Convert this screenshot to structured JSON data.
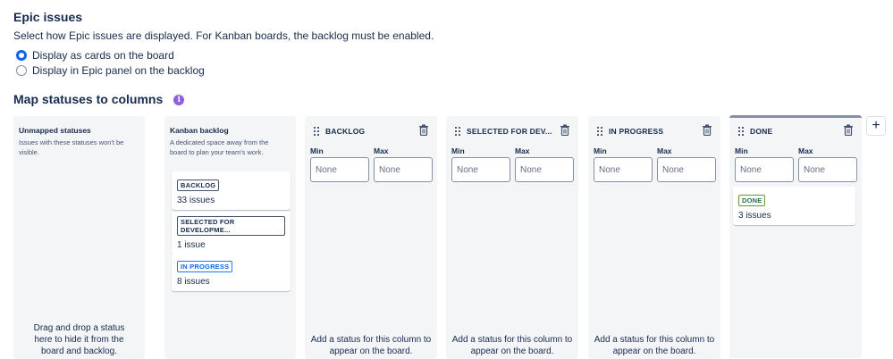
{
  "epic": {
    "title": "Epic issues",
    "description": "Select how Epic issues are displayed. For Kanban boards, the backlog must be enabled.",
    "options": [
      {
        "label": "Display as cards on the board",
        "checked": true
      },
      {
        "label": "Display in Epic panel on the backlog",
        "checked": false
      }
    ]
  },
  "map": {
    "title": "Map statuses to columns",
    "info_icon": "i"
  },
  "unmapped": {
    "title": "Unmapped statuses",
    "subtitle": "Issues with these statuses won't be visible.",
    "footer": "Drag and drop a status here to hide it from the board and backlog."
  },
  "kanban_backlog": {
    "title": "Kanban backlog",
    "subtitle": "A dedicated space away from the board to plan your team's work.",
    "cards": [
      {
        "status": "BACKLOG",
        "count": "33 issues"
      },
      {
        "status": "SELECTED FOR DEVELOPME...",
        "count": "1 issue"
      },
      {
        "status": "IN PROGRESS",
        "count": "8 issues"
      }
    ]
  },
  "columns": [
    {
      "name": "BACKLOG",
      "min_label": "Min",
      "max_label": "Max",
      "min_placeholder": "None",
      "max_placeholder": "None",
      "footer": "Add a status for this column to appear on the board."
    },
    {
      "name": "SELECTED FOR DEV...",
      "min_label": "Min",
      "max_label": "Max",
      "min_placeholder": "None",
      "max_placeholder": "None",
      "footer": "Add a status for this column to appear on the board."
    },
    {
      "name": "IN PROGRESS",
      "min_label": "Min",
      "max_label": "Max",
      "min_placeholder": "None",
      "max_placeholder": "None",
      "footer": "Add a status for this column to appear on the board."
    },
    {
      "name": "DONE",
      "min_label": "Min",
      "max_label": "Max",
      "min_placeholder": "None",
      "max_placeholder": "None",
      "card": {
        "status": "DONE",
        "count": "3 issues"
      }
    }
  ],
  "add_column_label": "+",
  "colors": {
    "accent": "#0c66e4",
    "info": "#8f5fdc",
    "done": "#216e4e"
  }
}
